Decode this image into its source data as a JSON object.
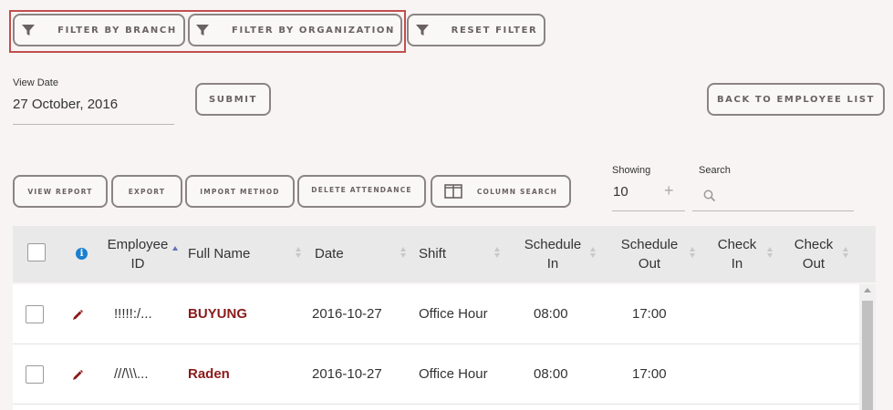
{
  "filters": {
    "filter_by_branch": "FILTER BY BRANCH",
    "filter_by_organization": "FILTER BY ORGANIZATION",
    "reset_filter": "RESET FILTER"
  },
  "view_date": {
    "label": "View Date",
    "value": "27 October, 2016"
  },
  "submit_label": "SUBMIT",
  "back_label": "BACK TO EMPLOYEE LIST",
  "toolbar": {
    "view_report": "VIEW REPORT",
    "export": "EXPORT",
    "import_method": "IMPORT METHOD",
    "delete_attendance": "DELETE ATTENDANCE",
    "column_search": "COLUMN SEARCH"
  },
  "showing": {
    "label": "Showing",
    "value": "10",
    "plus": "+"
  },
  "search": {
    "label": "Search",
    "placeholder": ""
  },
  "table": {
    "headers": {
      "employee_id_1": "Employee",
      "employee_id_2": "ID",
      "full_name": "Full Name",
      "date": "Date",
      "shift": "Shift",
      "schedule_in_1": "Schedule",
      "schedule_in_2": "In",
      "schedule_out_1": "Schedule",
      "schedule_out_2": "Out",
      "check_in_1": "Check",
      "check_in_2": "In",
      "check_out_1": "Check",
      "check_out_2": "Out"
    },
    "rows": [
      {
        "employee_id": "!!!!!:/...",
        "full_name": "BUYUNG",
        "date": "2016-10-27",
        "shift": "Office Hour",
        "schedule_in": "08:00",
        "schedule_out": "17:00",
        "check_in": "",
        "check_out": ""
      },
      {
        "employee_id": "///\\\\\\...",
        "full_name": "Raden",
        "date": "2016-10-27",
        "shift": "Office Hour",
        "schedule_in": "08:00",
        "schedule_out": "17:00",
        "check_in": "",
        "check_out": ""
      }
    ]
  },
  "colors": {
    "highlight": "#c0504d",
    "name_text": "#8b1a1a",
    "info_icon": "#1a7fd0",
    "sort_active": "#6670b8"
  }
}
